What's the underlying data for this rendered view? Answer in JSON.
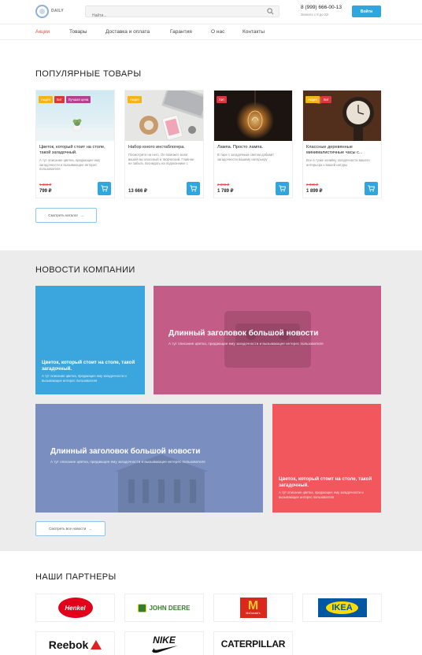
{
  "header": {
    "logo_text": "DAILY",
    "search_placeholder": "Найти...",
    "phone": "8 (999) 666-00-13",
    "worktime": "Звоните с 8 до 22!",
    "login_label": "Войти"
  },
  "nav": {
    "items": [
      "Акции",
      "Товары",
      "Доставка и оплата",
      "Гарантия",
      "О нас",
      "Контакты"
    ],
    "active": "Акции"
  },
  "popular": {
    "title": "ПОПУЛЯРНЫЕ ТОВАРЫ",
    "catalog_button": "Смотреть каталог",
    "products": [
      {
        "badges": [
          "Акция",
          "Хит",
          "Лучшая цена"
        ],
        "name": "Цветок, который стоит на столе, такой загадочный.",
        "desc": "А тут описание цветка, предающее ему загадочности и вызывающее интерес пользователя",
        "old_price": "1 399 ₽",
        "price": "799 ₽"
      },
      {
        "badges": [
          "Акция"
        ],
        "name": "Набор юного инстаблогера.",
        "desc": "Посмотрите на него. Он поможет всем вашей вы классный и творческий. Главное не забыть поснидать на подоконнике с",
        "old_price": "",
        "price": "13 666 ₽"
      },
      {
        "badges": [
          "Хит"
        ],
        "name": "Лампа. Просто лампа.",
        "desc": "В таре с загадочным светом добавит загадочности вашему интерьеру",
        "old_price": "2 399 ₽",
        "price": "1 789 ₽"
      },
      {
        "badges": [
          "Акция",
          "Хит"
        ],
        "name": "Классные деревянные минималистичные часы с...",
        "desc": "Все в тузке хопийку загадочности вашего интерьера к вашей натуры",
        "old_price": "2 399 ₽",
        "price": "1 899 ₽"
      }
    ]
  },
  "news": {
    "title": "НОВОСТИ КОМПАНИИ",
    "all_button": "Смотреть все новости",
    "items": [
      {
        "title": "Цветок, который стоит на столе, такой загадочный.",
        "desc": "А тут описание цветка, предающее ему загадочности и вызывающее интерес пользователя",
        "color": "#3ba6dd"
      },
      {
        "title": "Длинный заголовок большой новости",
        "desc": "А тут описание цветка, предающее ему загадочности и вызывающее интерес пользователя",
        "color": "#c35c86"
      },
      {
        "title": "Длинный заголовок большой новости",
        "desc": "А тут описание цветка, предающее ему загадочности и вызывающее интерес пользователя",
        "color": "#7a8fbf"
      },
      {
        "title": "Цветок, который стоит на столе, такой загадочный.",
        "desc": "А тут описание цветка, предающее ему загадочности и вызывающее интерес пользователя",
        "color": "#f2575e"
      }
    ]
  },
  "partners": {
    "title": "НАШИ ПАРТНЕРЫ",
    "logos": [
      "Henkel",
      "JOHN DEERE",
      "McDonald's",
      "IKEA",
      "Reebok",
      "NIKE",
      "CATERPILLAR"
    ]
  },
  "colors": {
    "accent": "#2ea6e0",
    "active_nav": "#e84b46",
    "badge_yellow": "#f2b511",
    "badge_red": "#d9363e",
    "badge_purple": "#b7408e"
  }
}
